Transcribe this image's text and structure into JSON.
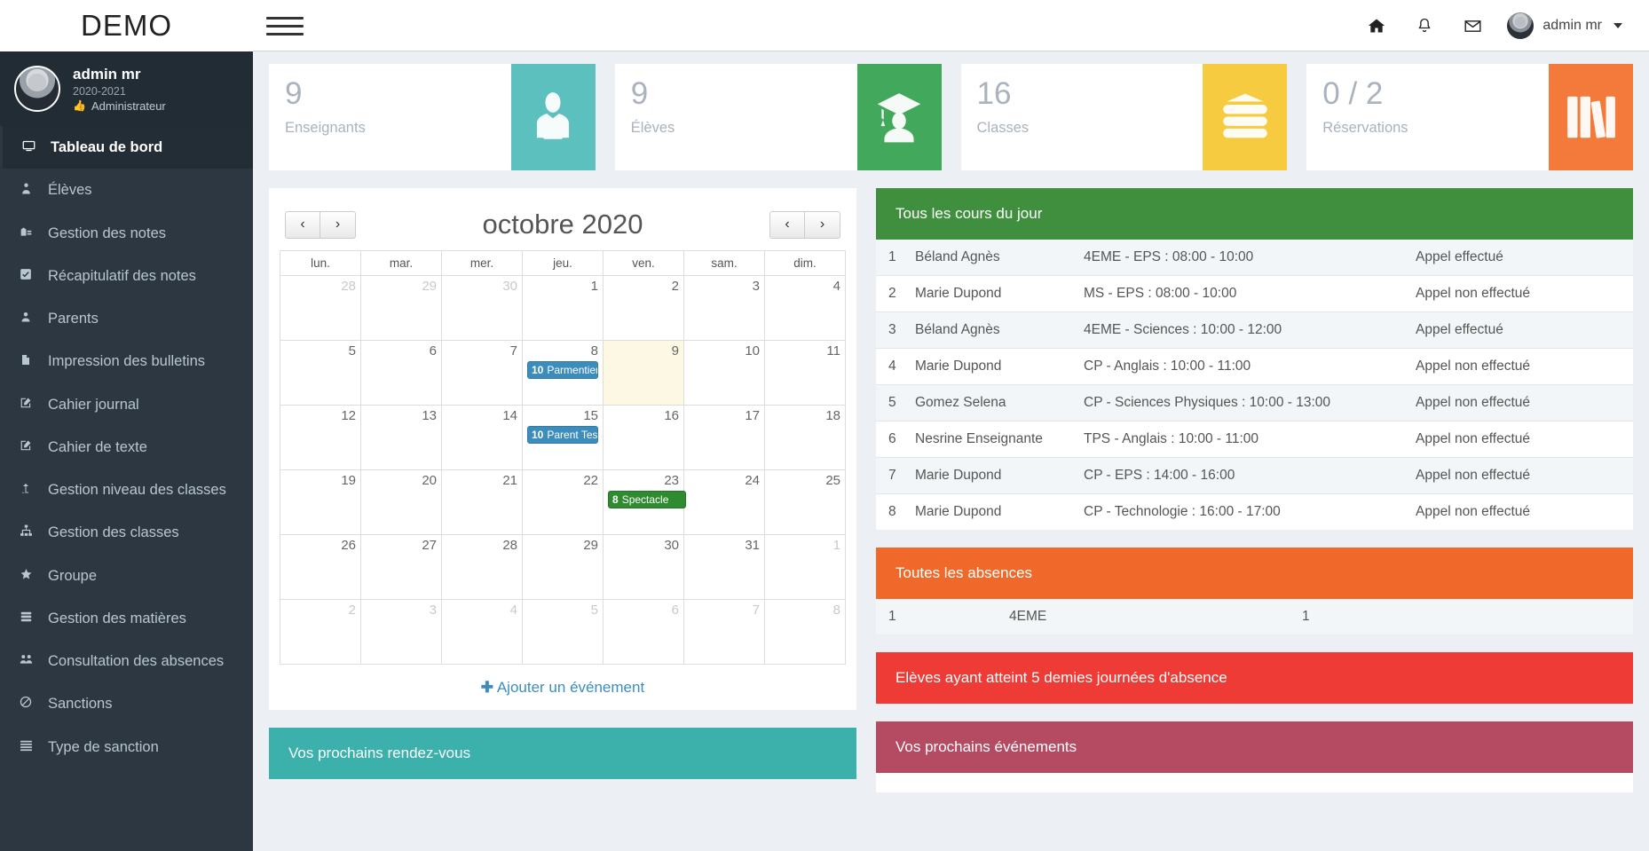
{
  "topbar": {
    "brand": "DEMO",
    "menu_toggle_name": "hamburger-menu",
    "icons": [
      "home-icon",
      "bell-icon",
      "envelope-icon"
    ],
    "user_name": "admin mr"
  },
  "sidebar": {
    "user": {
      "name": "admin mr",
      "year": "2020-2021",
      "role": "Administrateur"
    },
    "items": [
      {
        "label": "Tableau de bord",
        "icon": "desktop-icon",
        "active": true
      },
      {
        "label": "Élèves",
        "icon": "student-icon",
        "active": false
      },
      {
        "label": "Gestion des notes",
        "icon": "grades-icon",
        "active": false
      },
      {
        "label": "Récapitulatif des notes",
        "icon": "check-square-icon",
        "active": false
      },
      {
        "label": "Parents",
        "icon": "user-icon",
        "active": false
      },
      {
        "label": "Impression des bulletins",
        "icon": "file-icon",
        "active": false
      },
      {
        "label": "Cahier journal",
        "icon": "edit-icon",
        "active": false
      },
      {
        "label": "Cahier de texte",
        "icon": "edit-icon",
        "active": false
      },
      {
        "label": "Gestion niveau des classes",
        "icon": "level-up-icon",
        "active": false
      },
      {
        "label": "Gestion des classes",
        "icon": "sitemap-icon",
        "active": false
      },
      {
        "label": "Groupe",
        "icon": "star-icon",
        "active": false
      },
      {
        "label": "Gestion des matières",
        "icon": "books-icon",
        "active": false
      },
      {
        "label": "Consultation des absences",
        "icon": "group-icon",
        "active": false
      },
      {
        "label": "Sanctions",
        "icon": "ban-icon",
        "active": false
      },
      {
        "label": "Type de sanction",
        "icon": "list-icon",
        "active": false
      }
    ]
  },
  "stats": [
    {
      "value": "9",
      "label": "Enseignants",
      "color": "#5bc0be",
      "icon": "teacher-icon"
    },
    {
      "value": "9",
      "label": "Élèves",
      "color": "#42a85b",
      "icon": "graduate-icon"
    },
    {
      "value": "16",
      "label": "Classes",
      "color": "#f7cb3f",
      "icon": "books-stack-icon"
    },
    {
      "value": "0 / 2",
      "label": "Réservations",
      "color": "#f47a3c",
      "icon": "library-icon"
    }
  ],
  "calendar": {
    "title": "octobre 2020",
    "prev_label": "‹",
    "next_label": "›",
    "weekdays": [
      "lun.",
      "mar.",
      "mer.",
      "jeu.",
      "ven.",
      "sam.",
      "dim."
    ],
    "weeks": [
      [
        {
          "day": "28",
          "other": true
        },
        {
          "day": "29",
          "other": true
        },
        {
          "day": "30",
          "other": true
        },
        {
          "day": "1",
          "other": false
        },
        {
          "day": "2",
          "other": false
        },
        {
          "day": "3",
          "other": false
        },
        {
          "day": "4",
          "other": false
        }
      ],
      [
        {
          "day": "5",
          "other": false
        },
        {
          "day": "6",
          "other": false
        },
        {
          "day": "7",
          "other": false
        },
        {
          "day": "8",
          "other": false,
          "event": {
            "count": "10",
            "title": "Parmentier",
            "color": "blue"
          }
        },
        {
          "day": "9",
          "other": false,
          "today": true
        },
        {
          "day": "10",
          "other": false
        },
        {
          "day": "11",
          "other": false
        }
      ],
      [
        {
          "day": "12",
          "other": false
        },
        {
          "day": "13",
          "other": false
        },
        {
          "day": "14",
          "other": false
        },
        {
          "day": "15",
          "other": false,
          "event": {
            "count": "10",
            "title": "Parent Test",
            "color": "blue"
          }
        },
        {
          "day": "16",
          "other": false
        },
        {
          "day": "17",
          "other": false
        },
        {
          "day": "18",
          "other": false
        }
      ],
      [
        {
          "day": "19",
          "other": false
        },
        {
          "day": "20",
          "other": false
        },
        {
          "day": "21",
          "other": false
        },
        {
          "day": "22",
          "other": false
        },
        {
          "day": "23",
          "other": false,
          "event": {
            "count": "8",
            "title": "Spectacle",
            "color": "green"
          }
        },
        {
          "day": "24",
          "other": false
        },
        {
          "day": "25",
          "other": false
        }
      ],
      [
        {
          "day": "26",
          "other": false
        },
        {
          "day": "27",
          "other": false
        },
        {
          "day": "28",
          "other": false
        },
        {
          "day": "29",
          "other": false
        },
        {
          "day": "30",
          "other": false
        },
        {
          "day": "31",
          "other": false
        },
        {
          "day": "1",
          "other": true
        }
      ],
      [
        {
          "day": "2",
          "other": true
        },
        {
          "day": "3",
          "other": true
        },
        {
          "day": "4",
          "other": true
        },
        {
          "day": "5",
          "other": true
        },
        {
          "day": "6",
          "other": true
        },
        {
          "day": "7",
          "other": true
        },
        {
          "day": "8",
          "other": true
        }
      ]
    ],
    "add_event_label": "Ajouter un événement"
  },
  "appointments_panel": {
    "title": "Vos prochains rendez-vous"
  },
  "courses_panel": {
    "title": "Tous les cours du jour",
    "rows": [
      {
        "idx": "1",
        "teacher": "Béland Agnès",
        "course": "4EME - EPS : 08:00 - 10:00",
        "status": "Appel effectué",
        "done": true
      },
      {
        "idx": "2",
        "teacher": "Marie Dupond",
        "course": "MS - EPS : 08:00 - 10:00",
        "status": "Appel non effectué",
        "done": false
      },
      {
        "idx": "3",
        "teacher": "Béland Agnès",
        "course": "4EME - Sciences : 10:00 - 12:00",
        "status": "Appel effectué",
        "done": true
      },
      {
        "idx": "4",
        "teacher": "Marie Dupond",
        "course": "CP - Anglais : 10:00 - 11:00",
        "status": "Appel non effectué",
        "done": false
      },
      {
        "idx": "5",
        "teacher": "Gomez Selena",
        "course": "CP - Sciences Physiques : 10:00 - 13:00",
        "status": "Appel non effectué",
        "done": false
      },
      {
        "idx": "6",
        "teacher": "Nesrine Enseignante",
        "course": "TPS - Anglais : 10:00 - 11:00",
        "status": "Appel non effectué",
        "done": false
      },
      {
        "idx": "7",
        "teacher": "Marie Dupond",
        "course": "CP - EPS : 14:00 - 16:00",
        "status": "Appel non effectué",
        "done": false
      },
      {
        "idx": "8",
        "teacher": "Marie Dupond",
        "course": "CP - Technologie : 16:00 - 17:00",
        "status": "Appel non effectué",
        "done": false
      }
    ]
  },
  "absences_panel": {
    "title": "Toutes les absences",
    "rows": [
      {
        "idx": "1",
        "classe": "4EME",
        "count": "1"
      }
    ]
  },
  "threshold_panel": {
    "title": "Elèves ayant atteint 5 demies journées d'absence"
  },
  "events_panel": {
    "title": "Vos prochains événements"
  },
  "colors": {
    "teal": "#3cb0ab",
    "green": "#3f8f3f",
    "orange": "#f0692a",
    "red": "#ef3b35",
    "maroon": "#b54b63",
    "link": "#3c8dbc",
    "sidebar": "#2d3741"
  }
}
